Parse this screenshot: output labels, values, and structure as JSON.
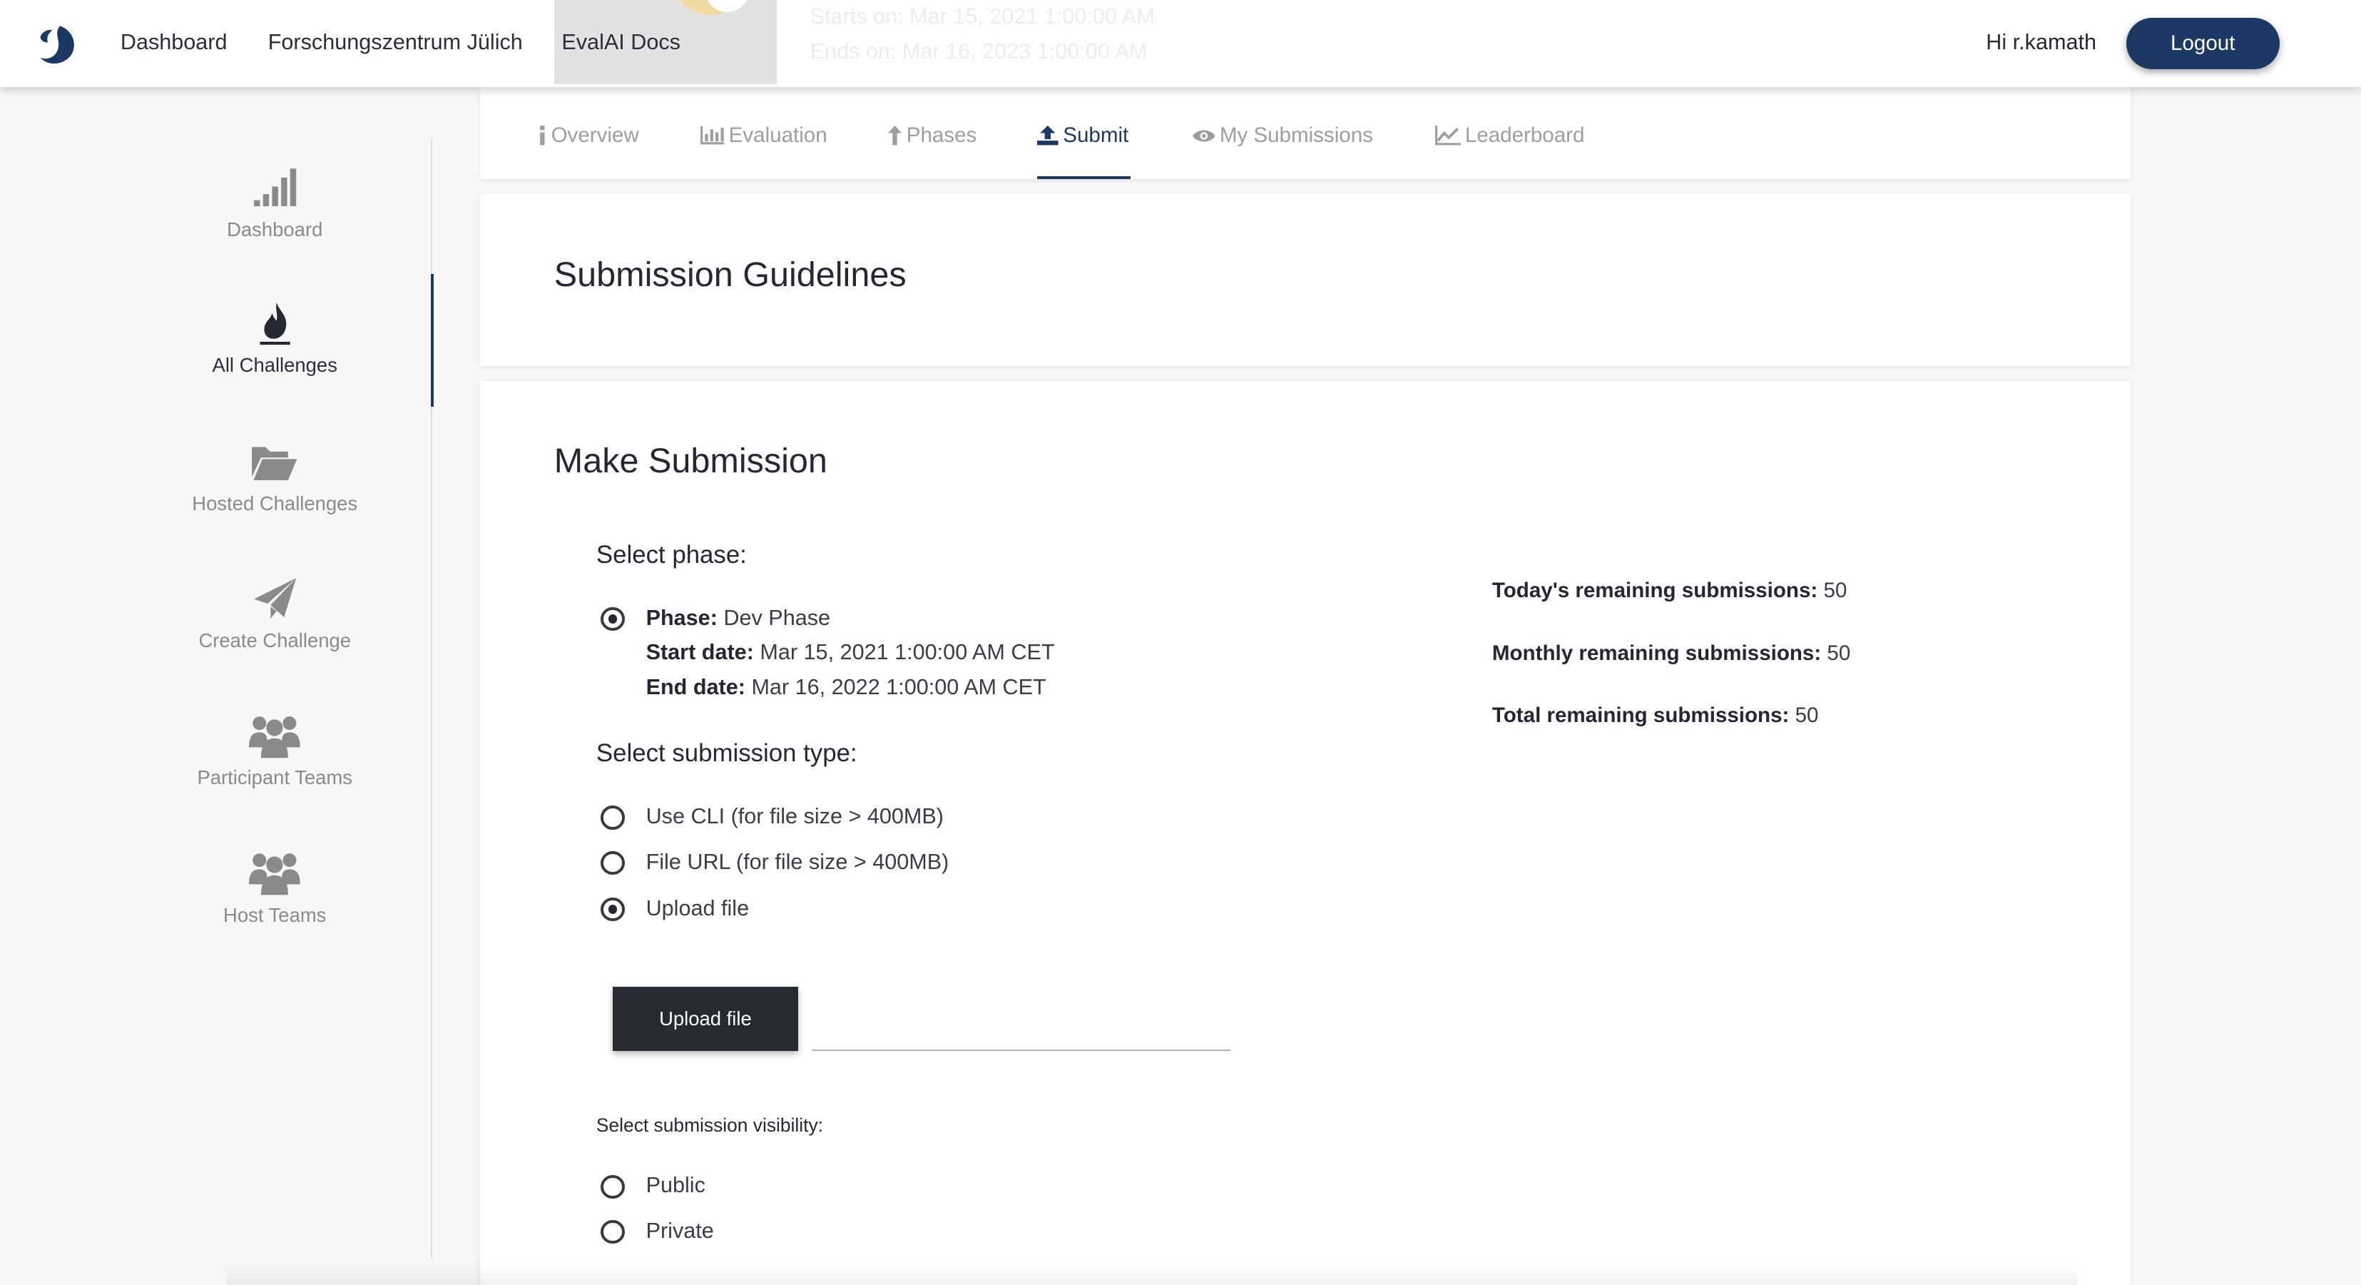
{
  "navbar": {
    "links": [
      "Dashboard",
      "Forschungszentrum Jülich",
      "EvalAI Docs"
    ],
    "faded_start": "Starts on: Mar 15, 2021 1:00:00 AM",
    "faded_end": "Ends on: Mar 16, 2023 1:00:00 AM",
    "greeting_prefix": "Hi",
    "username": "r.kamath",
    "logout_label": "Logout"
  },
  "sidebar": {
    "items": [
      {
        "label": "Dashboard",
        "icon": "signal-bars-icon"
      },
      {
        "label": "All Challenges",
        "icon": "flame-icon",
        "active": true
      },
      {
        "label": "Hosted Challenges",
        "icon": "folder-open-icon"
      },
      {
        "label": "Create Challenge",
        "icon": "paper-plane-icon"
      },
      {
        "label": "Participant Teams",
        "icon": "users-icon"
      },
      {
        "label": "Host Teams",
        "icon": "users-icon"
      }
    ]
  },
  "tabs": [
    {
      "label": "Overview",
      "icon": "info-icon"
    },
    {
      "label": "Evaluation",
      "icon": "bar-chart-icon"
    },
    {
      "label": "Phases",
      "icon": "arrow-up-icon"
    },
    {
      "label": "Submit",
      "icon": "upload-icon",
      "active": true
    },
    {
      "label": "My Submissions",
      "icon": "eye-icon"
    },
    {
      "label": "Leaderboard",
      "icon": "line-chart-icon"
    }
  ],
  "guidelines": {
    "title": "Submission Guidelines"
  },
  "submission": {
    "title": "Make Submission",
    "select_phase_label": "Select phase:",
    "phase": {
      "phase_key": "Phase:",
      "phase_value": "Dev Phase",
      "start_key": "Start date:",
      "start_value": "Mar 15, 2021 1:00:00 AM CET",
      "end_key": "End date:",
      "end_value": "Mar 16, 2022 1:00:00 AM CET",
      "selected": true
    },
    "type_label": "Select submission type:",
    "types": [
      {
        "label": "Use CLI (for file size > 400MB)",
        "selected": false
      },
      {
        "label": "File URL (for file size > 400MB)",
        "selected": false
      },
      {
        "label": "Upload file",
        "selected": true
      }
    ],
    "upload_button": "Upload file",
    "visibility_label": "Select submission visibility:",
    "visibility_options": [
      {
        "label": "Public",
        "selected": false
      },
      {
        "label": "Private",
        "selected": false
      }
    ]
  },
  "remaining": {
    "today_key": "Today's remaining submissions:",
    "today_value": "50",
    "monthly_key": "Monthly remaining submissions:",
    "monthly_value": "50",
    "total_key": "Total remaining submissions:",
    "total_value": "50"
  },
  "colors": {
    "brand": "#1c3965",
    "dark_button": "#252a33",
    "muted": "#9e9e9e"
  }
}
